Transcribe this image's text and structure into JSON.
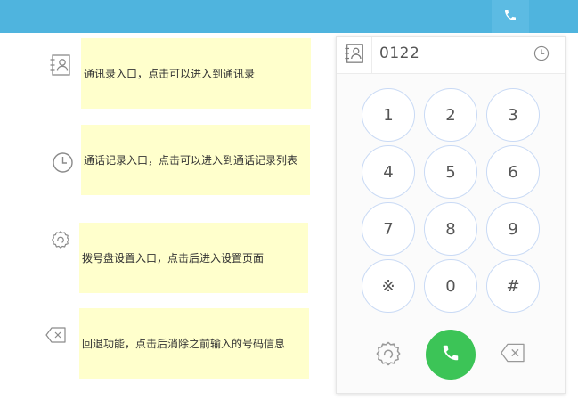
{
  "dialer": {
    "number": "0122",
    "keys": [
      "1",
      "2",
      "3",
      "4",
      "5",
      "6",
      "7",
      "8",
      "9",
      "※",
      "0",
      "#"
    ]
  },
  "annotations": {
    "contacts": "通讯录入口，点击可以进入到通讯录",
    "history": "通话记录入口，点击可以进入到通话记录列表",
    "settings": "拨号盘设置入口，点击后进入设置页面",
    "backspace": "回退功能，点击后消除之前输入的号码信息"
  },
  "icons": {
    "topbar": "phone-icon",
    "contacts": "contacts-book-icon",
    "history": "clock-icon",
    "settings": "gear-icon",
    "backspace": "backspace-icon",
    "call": "phone-icon"
  },
  "colors": {
    "topbar": "#4fb4de",
    "note_background": "#ffffcc",
    "call_button": "#3cc457",
    "key_border": "#c9daf5"
  }
}
